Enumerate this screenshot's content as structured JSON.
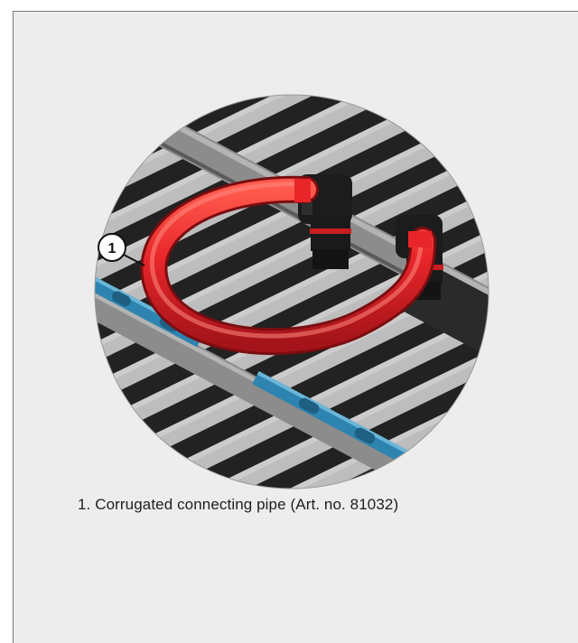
{
  "figure": {
    "callout_number": "1",
    "caption": "1. Corrugated connecting pipe (Art. no. 81032)",
    "colors": {
      "panel_background": "#ededed",
      "pipe": "#e8262a",
      "fitting": "#1c1c1c",
      "seal_ring": "#c81e22",
      "rail": "#2e84b0",
      "joist": "#222222",
      "floor": "#bdbdbd"
    }
  }
}
